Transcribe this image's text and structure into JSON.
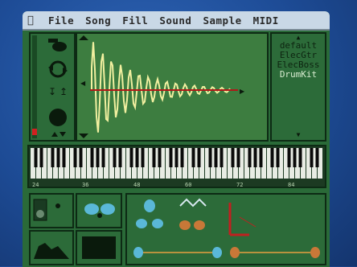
{
  "menu": {
    "apple_icon": "apple-icon",
    "items": [
      "File",
      "Song",
      "Fill",
      "Sound",
      "Sample",
      "MIDI"
    ]
  },
  "presets": {
    "items": [
      "default",
      "ElecGtr",
      "ElecBoss",
      "DrumKit"
    ],
    "selected_index": 3
  },
  "keyboard": {
    "octave_labels": [
      "24",
      "36",
      "48",
      "60",
      "72",
      "84"
    ]
  },
  "tools": {
    "icons": [
      "brush-icon",
      "cycle-icon",
      "transpose-icon",
      "record-icon",
      "up-down-icon"
    ]
  },
  "colors": {
    "screen_bg": "#2a6a38",
    "wave_bg": "#3d7d40",
    "waveform": "#f2f0a0",
    "baseline": "#b01818",
    "menubar": "#c9d8e6",
    "preset_selected": "#d8ecd0"
  }
}
